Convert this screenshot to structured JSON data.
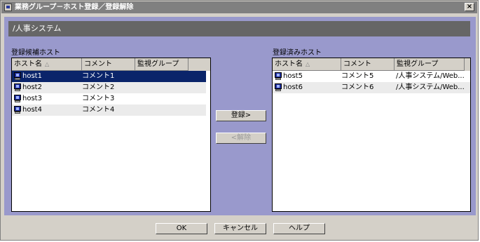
{
  "window": {
    "title": "業務グループ－ホスト登録／登録解除"
  },
  "path": "/人事システム",
  "candidates": {
    "label": "登録候補ホスト",
    "columns": {
      "host": "ホスト名",
      "comment": "コメント",
      "group": "監視グループ"
    },
    "sort_indicator": "△",
    "rows": [
      {
        "host": "host1",
        "comment": "コメント1",
        "group": "",
        "selected": true
      },
      {
        "host": "host2",
        "comment": "コメント2",
        "group": ""
      },
      {
        "host": "host3",
        "comment": "コメント3",
        "group": ""
      },
      {
        "host": "host4",
        "comment": "コメント4",
        "group": ""
      }
    ]
  },
  "registered": {
    "label": "登録済みホスト",
    "columns": {
      "host": "ホスト名",
      "comment": "コメント",
      "group": "監視グループ"
    },
    "sort_indicator": "△",
    "rows": [
      {
        "host": "host5",
        "comment": "コメント5",
        "group": "/人事システム/Web..."
      },
      {
        "host": "host6",
        "comment": "コメント6",
        "group": "/人事システム/Web..."
      }
    ]
  },
  "actions": {
    "register": "登録>",
    "unregister": "<解除"
  },
  "footer": {
    "ok": "OK",
    "cancel": "キャンセル",
    "help": "ヘルプ"
  },
  "close_glyph": "×",
  "colors": {
    "selection": "#0a246a",
    "panel": "#9999cc",
    "title_bar": "#808080"
  }
}
